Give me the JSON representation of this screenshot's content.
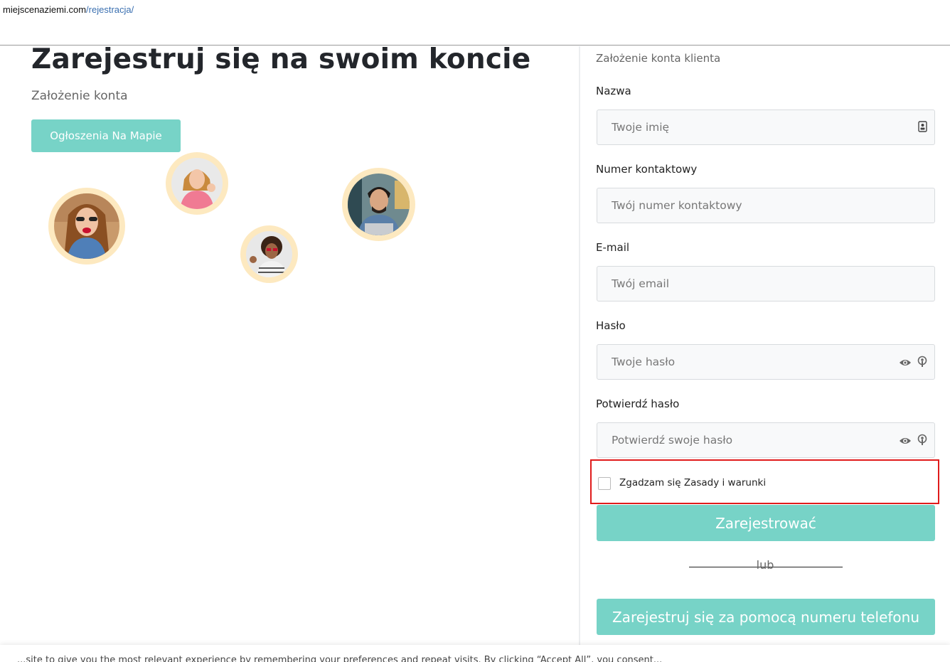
{
  "browser": {
    "url_host": "miejscenaziemi.com",
    "url_path": "/rejestracja/"
  },
  "hero": {
    "title": "Zarejestruj się na swoim koncie",
    "subtitle": "Założenie konta",
    "map_button": "Ogłoszenia Na Mapie"
  },
  "form": {
    "title": "Założenie konta klienta",
    "name": {
      "label": "Nazwa",
      "placeholder": "Twoje imię",
      "icon": "contact-card-icon"
    },
    "phone": {
      "label": "Numer kontaktowy",
      "placeholder": "Twój numer kontaktowy"
    },
    "email": {
      "label": "E-mail",
      "placeholder": "Twój email"
    },
    "password": {
      "label": "Hasło",
      "placeholder": "Twoje hasło",
      "icons": [
        "eye-icon",
        "key-icon"
      ]
    },
    "confirm_password": {
      "label": "Potwierdź hasło",
      "placeholder": "Potwierdź swoje hasło",
      "icons": [
        "eye-icon",
        "key-icon"
      ]
    },
    "terms": {
      "label": "Zgadzam się Zasady i warunki",
      "checked": false
    },
    "register_button": "Zarejestrować",
    "or_text": "lub",
    "phone_register_button": "Zarejestruj się za pomocą numeru telefonu"
  },
  "cookie_banner": {
    "text": "...site to give you the most relevant experience by remembering your preferences and repeat visits. By clicking “Accept All”, you consent..."
  },
  "colors": {
    "accent": "#77d3c7",
    "highlight_border": "#e01b1b",
    "avatar_ring": "#fde9c0"
  }
}
